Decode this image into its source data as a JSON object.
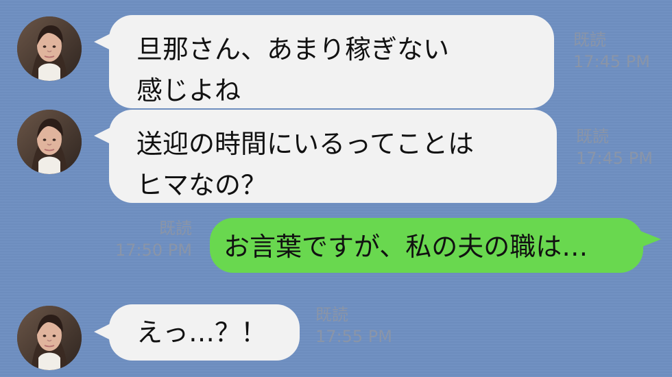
{
  "messages": [
    {
      "sender": "incoming",
      "lines": [
        "旦那さん、あまり稼ぎない",
        "感じよね"
      ],
      "read": "既読",
      "time": "17:45 PM"
    },
    {
      "sender": "incoming",
      "lines": [
        "送迎の時間にいるってことは",
        "ヒマなの？"
      ],
      "read": "既読",
      "time": "17:45 PM"
    },
    {
      "sender": "outgoing",
      "lines": [
        "お言葉ですが、私の夫の職は…"
      ],
      "read": "既読",
      "time": "17:50 PM"
    },
    {
      "sender": "incoming",
      "lines": [
        "えっ…？！"
      ],
      "read": "既読",
      "time": "17:55 PM"
    }
  ]
}
